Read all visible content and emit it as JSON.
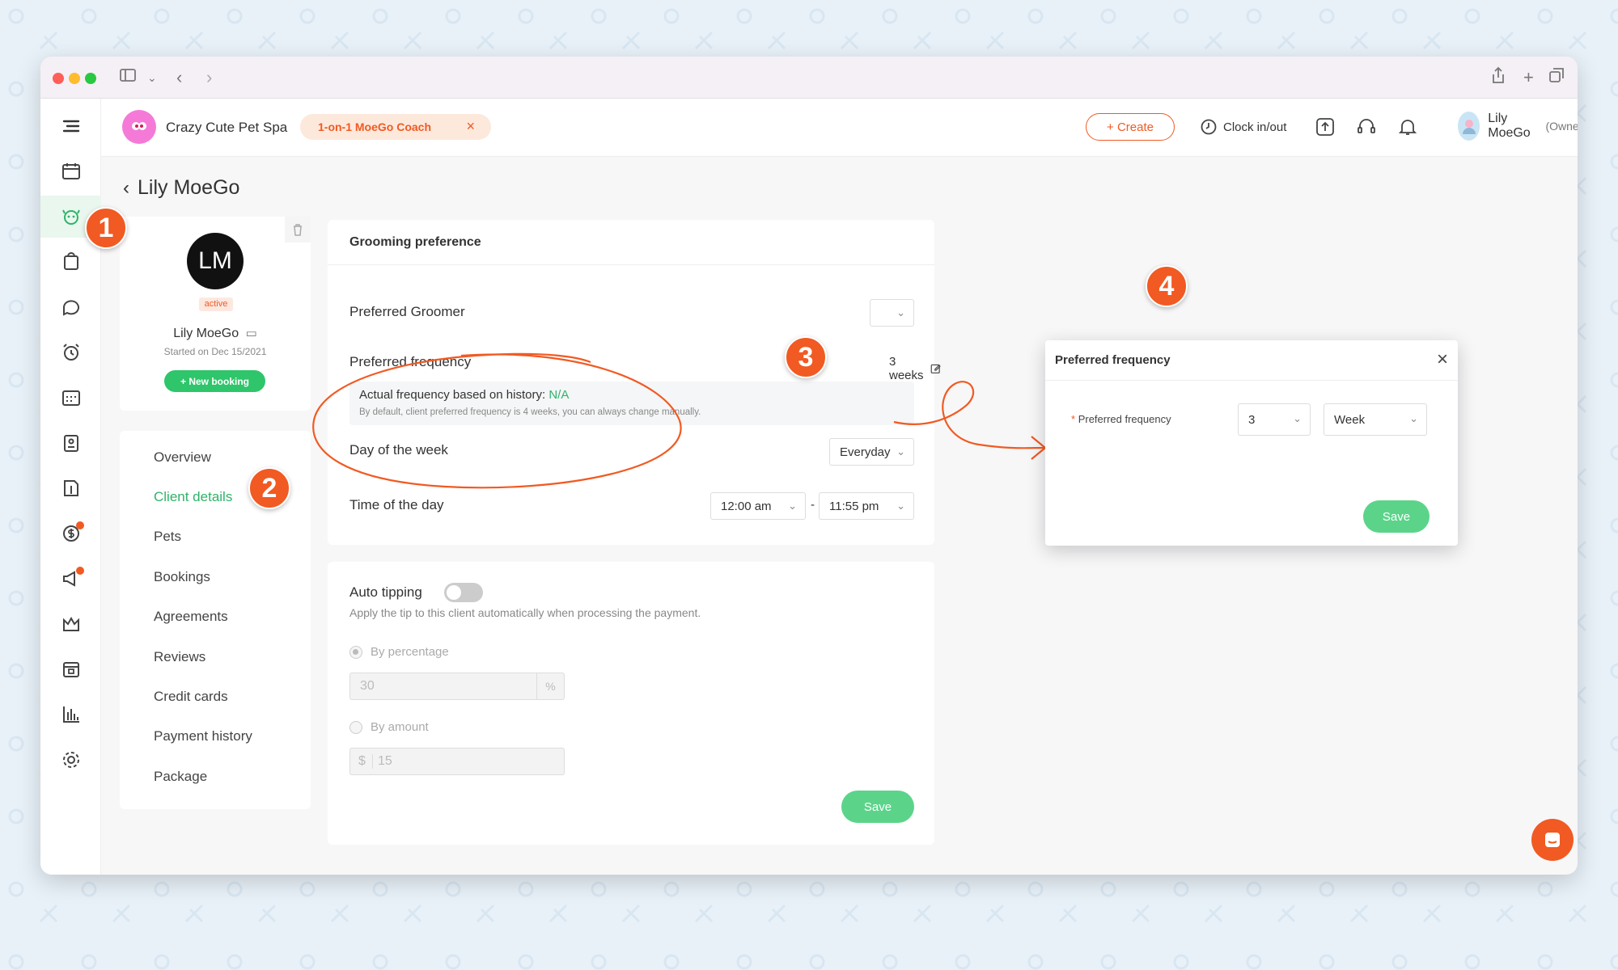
{
  "window": {
    "traffic_lights": [
      "#fe5f57",
      "#febc2e",
      "#28c840"
    ]
  },
  "sidebar": {
    "items": [
      {
        "icon": "menu-icon"
      },
      {
        "icon": "calendar-icon"
      },
      {
        "icon": "client-pet-icon",
        "active": true
      },
      {
        "icon": "retail-bag-icon"
      },
      {
        "icon": "message-icon"
      },
      {
        "icon": "alarm-clock-icon"
      },
      {
        "icon": "schedule-icon"
      },
      {
        "icon": "clipboard-icon"
      },
      {
        "icon": "map-icon"
      },
      {
        "icon": "payments-icon",
        "badge": true
      },
      {
        "icon": "marketing-megaphone-icon",
        "badge": true
      },
      {
        "icon": "crown-icon"
      },
      {
        "icon": "calendar-settings-icon"
      },
      {
        "icon": "reports-chart-icon"
      },
      {
        "icon": "settings-gear-icon"
      }
    ]
  },
  "topbar": {
    "business_name": "Crazy Cute Pet Spa",
    "coach_label": "1-on-1 MoeGo Coach",
    "create_label": "+ Create",
    "clock_label": "Clock in/out",
    "user_name": "Lily MoeGo",
    "user_role": "(Owner)"
  },
  "page": {
    "title": "Lily MoeGo"
  },
  "profile": {
    "initials": "LM",
    "status": "active",
    "name": "Lily MoeGo",
    "started": "Started on Dec 15/2021",
    "new_booking": "+ New booking"
  },
  "nav": {
    "items": [
      "Overview",
      "Client details",
      "Pets",
      "Bookings",
      "Agreements",
      "Reviews",
      "Credit cards",
      "Payment history",
      "Package"
    ],
    "active_index": 1
  },
  "grooming": {
    "title": "Grooming preference",
    "groomer_label": "Preferred Groomer",
    "frequency_label": "Preferred frequency",
    "frequency_value": "3 weeks",
    "history_prefix": "Actual frequency based on history:",
    "history_value": "N/A",
    "history_note": "By default, client preferred frequency is 4 weeks, you can always change manually.",
    "day_label": "Day of the week",
    "day_value": "Everyday",
    "time_label": "Time of the day",
    "time_start": "12:00 am",
    "time_sep": "-",
    "time_end": "11:55 pm"
  },
  "tipping": {
    "title": "Auto tipping",
    "description": "Apply the tip to this client automatically when processing the payment.",
    "by_percentage": "By percentage",
    "percentage_value": "30",
    "percent_symbol": "%",
    "by_amount": "By amount",
    "currency_symbol": "$",
    "amount_value": "15",
    "save_label": "Save",
    "enabled": false
  },
  "modal": {
    "title": "Preferred frequency",
    "required_mark": "*",
    "field_label": "Preferred frequency",
    "number_value": "3",
    "unit_value": "Week",
    "save_label": "Save"
  },
  "steps": [
    "1",
    "2",
    "3",
    "4"
  ],
  "colors": {
    "accent": "#f15a22",
    "green": "#2fb36a",
    "button_green": "#5bd48a"
  }
}
